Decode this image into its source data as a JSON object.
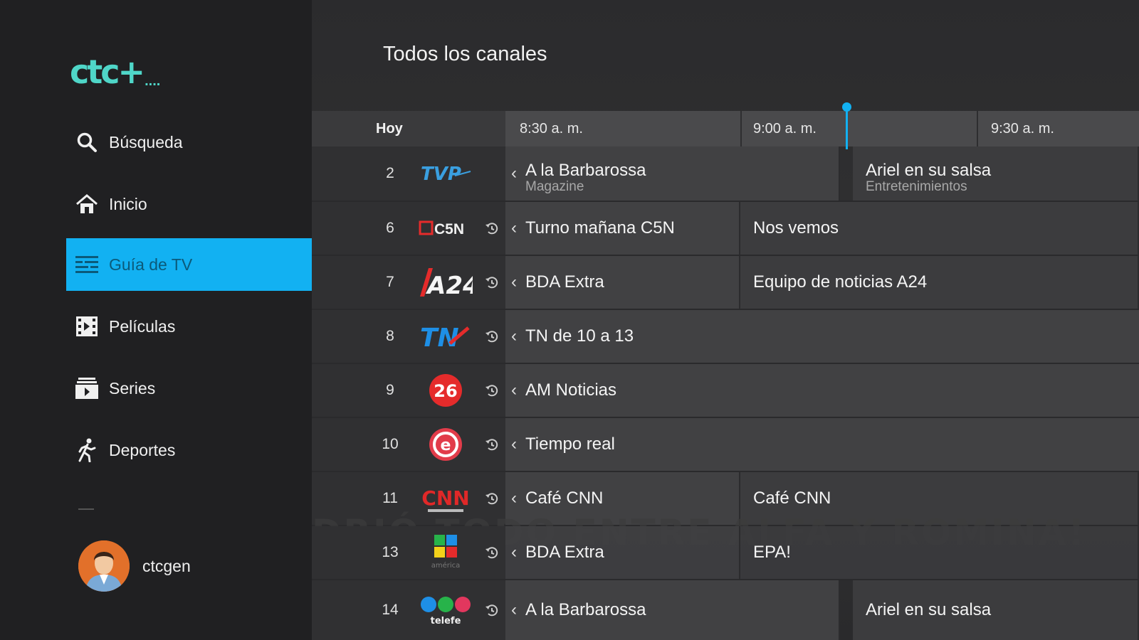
{
  "app": {
    "logo_text": "ctc+",
    "logo_suffix": "...."
  },
  "sidebar": {
    "items": [
      {
        "label": "Búsqueda",
        "icon": "search-icon"
      },
      {
        "label": "Inicio",
        "icon": "home-icon"
      },
      {
        "label": "Guía de TV",
        "icon": "tv-guide-icon",
        "active": true
      },
      {
        "label": "Películas",
        "icon": "movie-icon"
      },
      {
        "label": "Series",
        "icon": "series-icon"
      },
      {
        "label": "Deportes",
        "icon": "running-icon"
      }
    ],
    "profile": {
      "name": "ctcgen",
      "icon": "avatar-icon"
    }
  },
  "guide": {
    "title": "Todos los canales",
    "day": "Hoy",
    "times": [
      "8:30 a. m.",
      "9:00 a. m.",
      "9:30 a. m."
    ],
    "watermark": "DRIÓ TODO ENTRE ALFA Y ROMINA!",
    "channels": [
      {
        "number": "2",
        "logo": "TVP",
        "programs": [
          {
            "title": "A la Barbarossa",
            "subtitle": "Magazine"
          },
          {
            "title": "Ariel en su salsa",
            "subtitle": "Entretenimientos"
          }
        ]
      },
      {
        "number": "6",
        "logo": "C5N",
        "programs": [
          {
            "title": "Turno mañana C5N"
          },
          {
            "title": "Nos vemos"
          }
        ]
      },
      {
        "number": "7",
        "logo": "A24",
        "programs": [
          {
            "title": "BDA Extra"
          },
          {
            "title": "Equipo de noticias A24"
          }
        ]
      },
      {
        "number": "8",
        "logo": "TN",
        "programs": [
          {
            "title": "TN de 10 a 13"
          }
        ]
      },
      {
        "number": "9",
        "logo": "26",
        "programs": [
          {
            "title": "AM Noticias"
          }
        ]
      },
      {
        "number": "10",
        "logo": "e",
        "programs": [
          {
            "title": "Tiempo real"
          }
        ]
      },
      {
        "number": "11",
        "logo": "CNN",
        "programs": [
          {
            "title": "Café CNN"
          },
          {
            "title": "Café CNN"
          }
        ]
      },
      {
        "number": "13",
        "logo": "américa",
        "programs": [
          {
            "title": "BDA Extra"
          },
          {
            "title": "EPA!"
          }
        ]
      },
      {
        "number": "14",
        "logo": "telefe",
        "programs": [
          {
            "title": "A la Barbarossa"
          },
          {
            "title": "Ariel en su salsa"
          }
        ]
      }
    ]
  },
  "colors": {
    "accent": "#12b1f2",
    "brand": "#4fd6c8",
    "sidebar_bg": "#202022"
  }
}
